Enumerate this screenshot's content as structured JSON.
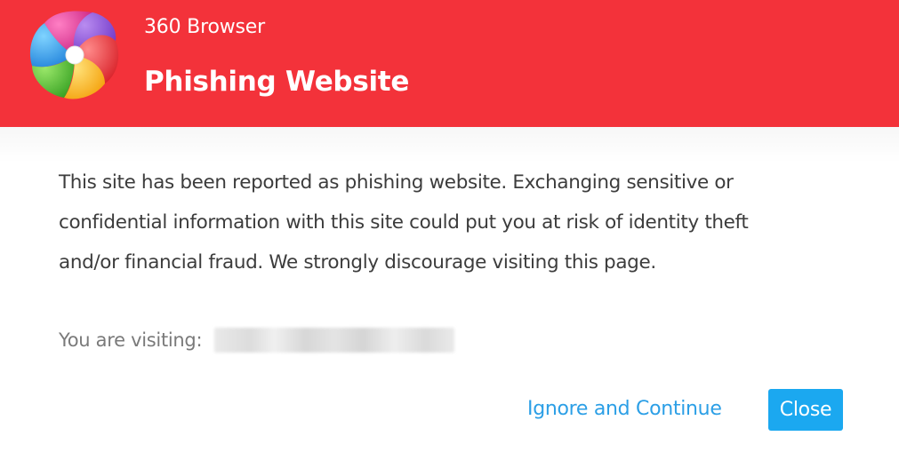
{
  "header": {
    "app_name": "360 Browser",
    "warning_title": "Phishing Website",
    "background_color": "#f3323a",
    "logo_icon": "360-browser-logo-icon"
  },
  "message": {
    "lines": [
      "This site has been reported as phishing website. Exchanging sensitive or",
      "confidential information with this site could put you at risk of identity theft",
      "and/or financial fraud. We strongly discourage visiting this page."
    ]
  },
  "visiting": {
    "label": "You are visiting:",
    "url_redacted": true
  },
  "actions": {
    "ignore_label": "Ignore and Continue",
    "close_label": "Close",
    "link_color": "#2c9fe6",
    "button_color": "#1ba8f0"
  }
}
